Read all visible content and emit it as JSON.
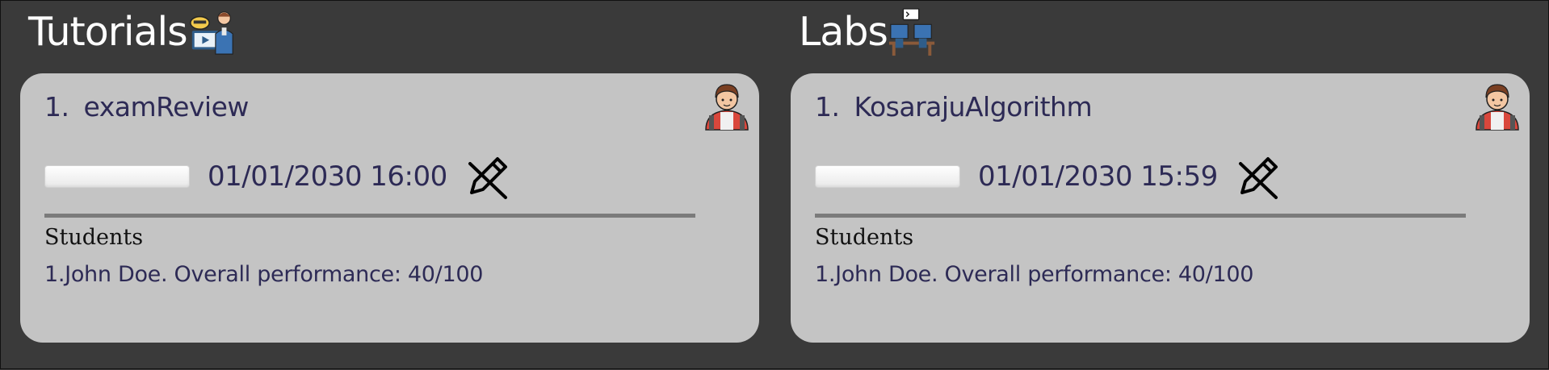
{
  "tutorials": {
    "title": "Tutorials",
    "icon": "teacher-presentation-icon",
    "card": {
      "index": "1.",
      "name": "examReview",
      "datetime": "01/01/2030 16:00",
      "students_heading": "Students",
      "students": [
        "1.John Doe. Overall performance: 40/100"
      ]
    }
  },
  "labs": {
    "title": "Labs",
    "icon": "computer-lab-icon",
    "card": {
      "index": "1.",
      "name": "KosarajuAlgorithm",
      "datetime": "01/01/2030 15:59",
      "students_heading": "Students",
      "students": [
        "1.John Doe. Overall performance: 40/100"
      ]
    }
  },
  "colors": {
    "background": "#3a3a3a",
    "card": "#c4c4c4",
    "text_primary": "#2d2a55",
    "divider": "#7b7b7b"
  }
}
